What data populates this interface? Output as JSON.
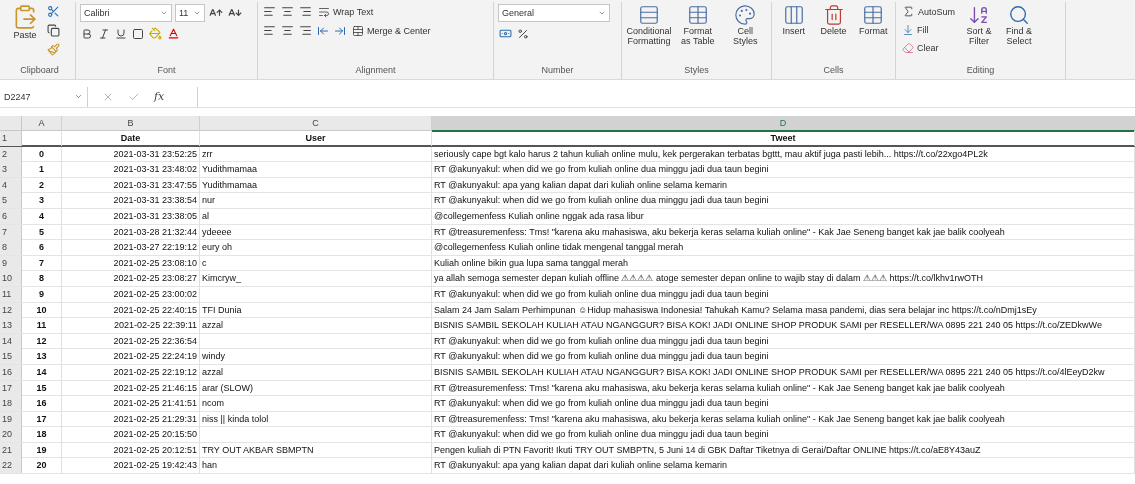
{
  "ribbon": {
    "clipboard": {
      "paste": "Paste",
      "label": "Clipboard"
    },
    "font": {
      "name": "Calibri",
      "size": "11",
      "label": "Font"
    },
    "alignment": {
      "wrap_text": "Wrap Text",
      "merge_center": "Merge & Center",
      "label": "Alignment"
    },
    "number": {
      "format": "General",
      "label": "Number"
    },
    "styles": {
      "buttons": [
        "Conditional Formatting",
        "Format as Table",
        "Cell Styles"
      ],
      "label": "Styles"
    },
    "cells": {
      "buttons": [
        "Insert",
        "Delete",
        "Format"
      ],
      "label": "Cells"
    },
    "editing": {
      "autosum": "AutoSum",
      "fill": "Fill",
      "clear": "Clear",
      "sort_filter": "Sort & Filter",
      "find_select": "Find & Select",
      "label": "Editing"
    }
  },
  "formula_bar": {
    "name_box": "D2247",
    "function_label": "fx"
  },
  "columns": [
    {
      "label": "A",
      "selected": false
    },
    {
      "label": "B",
      "selected": false
    },
    {
      "label": "C",
      "selected": false
    },
    {
      "label": "D",
      "selected": true
    }
  ],
  "header_row": {
    "number": "1",
    "cells": [
      "",
      "Date",
      "User",
      "Tweet"
    ]
  },
  "rows": [
    {
      "number": "2",
      "index": "0",
      "date": "2021-03-31 23:52:25",
      "user": "zrr",
      "tweet": "seriously cape bgt kalo harus 2 tahun kuliah online mulu, kek pergerakan terbatas bgttt, mau aktif juga pasti lebih... https://t.co/22xgo4PL2k"
    },
    {
      "number": "3",
      "index": "1",
      "date": "2021-03-31 23:48:02",
      "user": "Yudithmamaa",
      "tweet": "RT @akunyakul: when did we go from kuliah online dua minggu jadi dua taun begini"
    },
    {
      "number": "4",
      "index": "2",
      "date": "2021-03-31 23:47:55",
      "user": "Yudithmamaa",
      "tweet": "RT @akunyakul: apa yang kalian dapat dari kuliah online selama kemarin"
    },
    {
      "number": "5",
      "index": "3",
      "date": "2021-03-31 23:38:54",
      "user": "nur",
      "tweet": "RT @akunyakul: when did we go from kuliah online dua minggu jadi dua taun begini"
    },
    {
      "number": "6",
      "index": "4",
      "date": "2021-03-31 23:38:05",
      "user": "al",
      "tweet": "@collegemenfess Kuliah online nggak ada rasa libur"
    },
    {
      "number": "7",
      "index": "5",
      "date": "2021-03-28 21:32:44",
      "user": "ydeeee",
      "tweet": "RT @treasuremenfess: Tms! \"karena aku mahasiswa, aku bekerja keras selama kuliah online\" - Kak Jae Seneng banget kak jae balik coolyeah"
    },
    {
      "number": "8",
      "index": "6",
      "date": "2021-03-27 22:19:12",
      "user": "eury oh",
      "tweet": "@collegemenfess Kuliah online tidak mengenal tanggal merah"
    },
    {
      "number": "9",
      "index": "7",
      "date": "2021-02-25 23:08:10",
      "user": "c",
      "tweet": "Kuliah online bikin gua lupa sama tanggal merah"
    },
    {
      "number": "10",
      "index": "8",
      "date": "2021-02-25 23:08:27",
      "user": "Kimcryw_",
      "tweet": "ya allah semoga semester depan kuliah offline ⚠⚠⚠⚠ atoge semester depan online to wajib stay di dalam ⚠⚠⚠ https://t.co/lkhv1rwOTH"
    },
    {
      "number": "11",
      "index": "9",
      "date": "2021-02-25 23:00:02",
      "user": "",
      "tweet": "RT @akunyakul: when did we go from kuliah online dua minggu jadi dua taun begini"
    },
    {
      "number": "12",
      "index": "10",
      "date": "2021-02-25 22:40:15",
      "user": "TFI Dunia",
      "tweet": "Salam 24 Jam Salam Perhimpunan ☺Hidup mahasiswa Indonesia! Tahukah Kamu? Selama masa pandemi, dias sera belajar inc https://t.co/nDmj1sEy"
    },
    {
      "number": "13",
      "index": "11",
      "date": "2021-02-25 22:39:11",
      "user": "azzal",
      "tweet": "BISNIS SAMBIL SEKOLAH KULIAH ATAU NGANGGUR? BISA KOK! JADI ONLINE SHOP PRODUK SAMI per RESELLER/WA 0895 221 240 05 https://t.co/ZEDkwWe"
    },
    {
      "number": "14",
      "index": "12",
      "date": "2021-02-25 22:36:54",
      "user": "",
      "tweet": "RT @akunyakul: when did we go from kuliah online dua minggu jadi dua taun begini"
    },
    {
      "number": "15",
      "index": "13",
      "date": "2021-02-25 22:24:19",
      "user": "windy",
      "tweet": "RT @akunyakul: when did we go from kuliah online dua minggu jadi dua taun begini"
    },
    {
      "number": "16",
      "index": "14",
      "date": "2021-02-25 22:19:12",
      "user": "azzal",
      "tweet": "BISNIS SAMBIL SEKOLAH KULIAH ATAU NGANGGUR? BISA KOK! JADI ONLINE SHOP PRODUK SAMI per RESELLER/WA 0895 221 240 05 https://t.co/4lEeyD2kw"
    },
    {
      "number": "17",
      "index": "15",
      "date": "2021-02-25 21:46:15",
      "user": "arar (SLOW)",
      "tweet": "RT @treasuremenfess: Tms! \"karena aku mahasiswa, aku bekerja keras selama kuliah online\" - Kak Jae Seneng banget kak jae balik coolyeah"
    },
    {
      "number": "18",
      "index": "16",
      "date": "2021-02-25 21:41:51",
      "user": "ncom",
      "tweet": "RT @akunyakul: when did we go from kuliah online dua minggu jadi dua taun begini"
    },
    {
      "number": "19",
      "index": "17",
      "date": "2021-02-25 21:29:31",
      "user": "niss || kinda tolol",
      "tweet": "RT @treasuremenfess: Tms! \"karena aku mahasiswa, aku bekerja keras selama kuliah online\" - Kak Jae Seneng banget kak jae balik coolyeah"
    },
    {
      "number": "20",
      "index": "18",
      "date": "2021-02-25 20:15:50",
      "user": "",
      "tweet": "RT @akunyakul: when did we go from kuliah online dua minggu jadi dua taun begini"
    },
    {
      "number": "21",
      "index": "19",
      "date": "2021-02-25 20:12:51",
      "user": "TRY OUT AKBAR SBMPTN",
      "tweet": "Pengen kuliah di PTN Favorit! Ikuti TRY OUT SMBPTN, 5 Juni 14 di GBK Daftar Tiketnya di Gerai/Daftar ONLINE https://t.co/aE8Y43auZ"
    },
    {
      "number": "22",
      "index": "20",
      "date": "2021-02-25 19:42:43",
      "user": "han",
      "tweet": "RT @akunyakul: apa yang kalian dapat dari kuliah online selama kemarin"
    }
  ]
}
